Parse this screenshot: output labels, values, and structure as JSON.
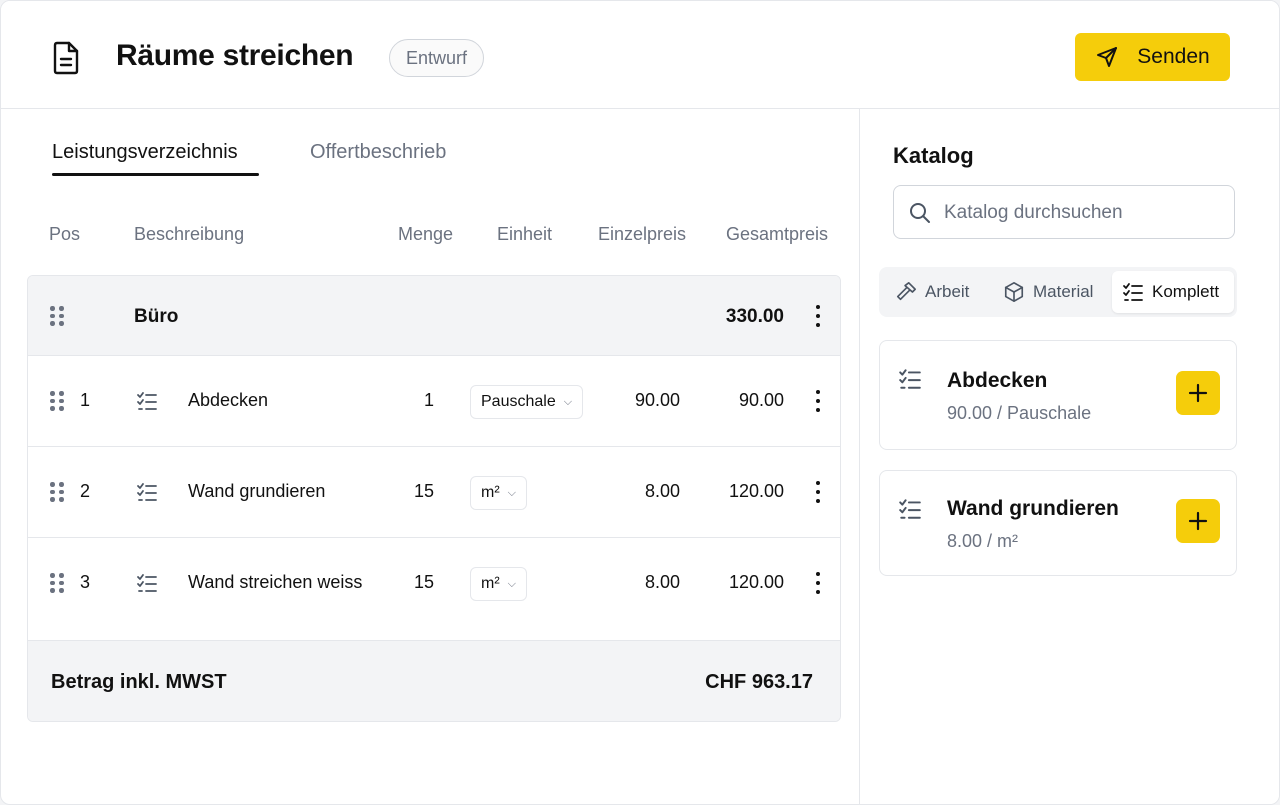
{
  "header": {
    "title": "Räume streichen",
    "status_badge": "Entwurf",
    "send_label": "Senden"
  },
  "tabs": [
    {
      "label": "Leistungsverzeichnis",
      "active": true
    },
    {
      "label": "Offertbeschrieb",
      "active": false
    }
  ],
  "table": {
    "columns": [
      "Pos",
      "Beschreibung",
      "Menge",
      "Einheit",
      "Einzelpreis",
      "Gesamtpreis"
    ],
    "group": {
      "name": "Büro",
      "total": "330.00"
    },
    "rows": [
      {
        "pos": "1",
        "description": "Abdecken",
        "quantity": "1",
        "unit": "Pauschale",
        "unit_price": "90.00",
        "total": "90.00"
      },
      {
        "pos": "2",
        "description": "Wand grundieren",
        "quantity": "15",
        "unit": "m²",
        "unit_price": "8.00",
        "total": "120.00"
      },
      {
        "pos": "3",
        "description": "Wand streichen weiss",
        "quantity": "15",
        "unit": "m²",
        "unit_price": "8.00",
        "total": "120.00"
      }
    ],
    "footer": {
      "label": "Betrag inkl. MWST",
      "value": "CHF 963.17"
    }
  },
  "catalog": {
    "title": "Katalog",
    "search_placeholder": "Katalog durchsuchen",
    "filters": [
      {
        "label": "Arbeit",
        "icon": "hammer-icon",
        "active": false
      },
      {
        "label": "Material",
        "icon": "box-icon",
        "active": false
      },
      {
        "label": "Komplett",
        "icon": "checklist-icon",
        "active": true
      }
    ],
    "items": [
      {
        "name": "Abdecken",
        "price_unit": "90.00 / Pauschale"
      },
      {
        "name": "Wand grundieren",
        "price_unit": "8.00 / m²"
      }
    ]
  },
  "colors": {
    "accent": "#f5cd0b",
    "muted_text": "#6b7280",
    "border": "#e5e7eb",
    "row_highlight": "#f3f4f6"
  }
}
